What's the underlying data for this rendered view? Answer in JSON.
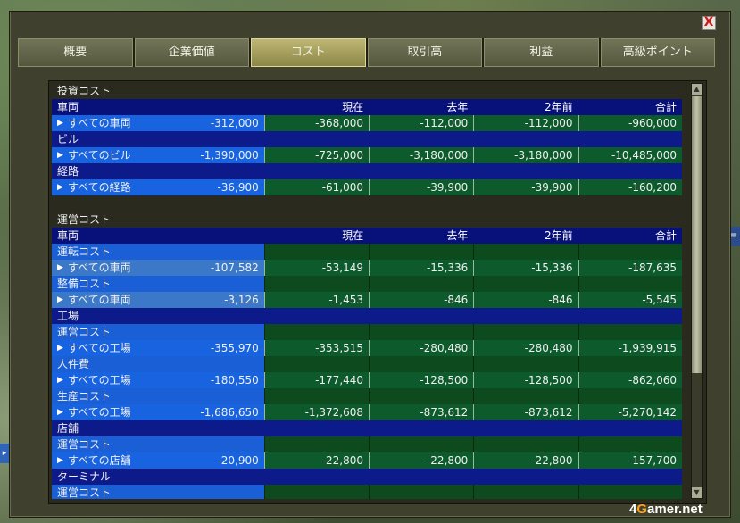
{
  "tabs": [
    "概要",
    "企業価値",
    "コスト",
    "取引高",
    "利益",
    "高級ポイント"
  ],
  "active_tab": 2,
  "close_label": "X",
  "logo": {
    "pre": "4",
    "g": "G",
    "post": "amer.net"
  },
  "rows": [
    {
      "kind": "section",
      "label": "投資コスト"
    },
    {
      "kind": "header",
      "cols": [
        "車両",
        "現在",
        "去年",
        "2年前",
        "合計"
      ]
    },
    {
      "kind": "item",
      "label": "すべての車両",
      "values": [
        "-312,000",
        "-368,000",
        "-112,000",
        "-960,000"
      ]
    },
    {
      "kind": "cat",
      "label": "ビル"
    },
    {
      "kind": "item",
      "label": "すべてのビル",
      "values": [
        "-1,390,000",
        "-725,000",
        "-3,180,000",
        "-10,485,000"
      ]
    },
    {
      "kind": "cat",
      "label": "経路"
    },
    {
      "kind": "item",
      "label": "すべての経路",
      "values": [
        "-36,900",
        "-61,000",
        "-39,900",
        "-160,200"
      ]
    },
    {
      "kind": "blank"
    },
    {
      "kind": "section",
      "label": "運営コスト"
    },
    {
      "kind": "header",
      "cols": [
        "車両",
        "現在",
        "去年",
        "2年前",
        "合計"
      ]
    },
    {
      "kind": "sub",
      "label": "運転コスト"
    },
    {
      "kind": "item",
      "light": true,
      "label": "すべての車両",
      "values": [
        "-107,582",
        "-53,149",
        "-15,336",
        "-187,635"
      ]
    },
    {
      "kind": "sub",
      "label": "整備コスト"
    },
    {
      "kind": "item",
      "light": true,
      "label": "すべての車両",
      "values": [
        "-3,126",
        "-1,453",
        "-846",
        "-5,545"
      ]
    },
    {
      "kind": "cat",
      "label": "工場"
    },
    {
      "kind": "sub",
      "label": "運営コスト"
    },
    {
      "kind": "item",
      "label": "すべての工場",
      "values": [
        "-355,970",
        "-353,515",
        "-280,480",
        "-1,939,915"
      ]
    },
    {
      "kind": "sub",
      "label": "人件費"
    },
    {
      "kind": "item",
      "label": "すべての工場",
      "values": [
        "-180,550",
        "-177,440",
        "-128,500",
        "-862,060"
      ]
    },
    {
      "kind": "sub",
      "label": "生産コスト"
    },
    {
      "kind": "item",
      "label": "すべての工場",
      "values": [
        "-1,686,650",
        "-1,372,608",
        "-873,612",
        "-5,270,142"
      ]
    },
    {
      "kind": "cat",
      "label": "店舗"
    },
    {
      "kind": "sub",
      "label": "運営コスト"
    },
    {
      "kind": "item",
      "label": "すべての店舗",
      "values": [
        "-20,900",
        "-22,800",
        "-22,800",
        "-157,700"
      ]
    },
    {
      "kind": "cat",
      "label": "ターミナル"
    },
    {
      "kind": "sub",
      "label": "運営コスト"
    }
  ]
}
